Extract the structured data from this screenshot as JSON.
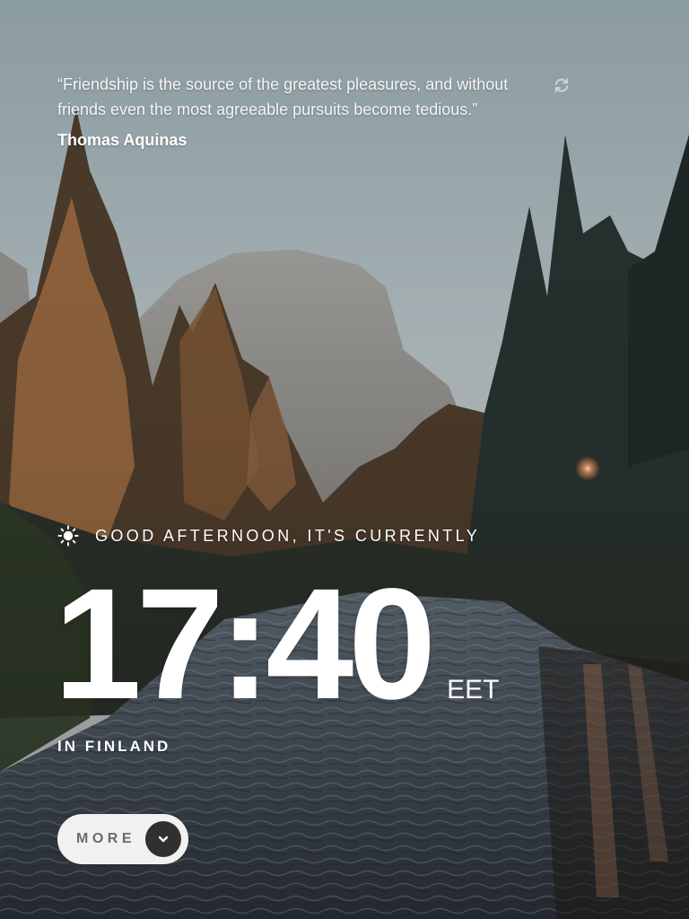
{
  "quote": {
    "text": "“Friendship is the source of the greatest pleasures, and without friends even the most agreeable pursuits become tedious.”",
    "author": "Thomas Aquinas",
    "refresh_icon": "refresh-icon"
  },
  "greeting": {
    "icon": "sun-icon",
    "text": "GOOD AFTERNOON, IT'S CURRENTLY"
  },
  "clock": {
    "time": "17:40",
    "timezone": "EET"
  },
  "location": {
    "text": "IN FINLAND"
  },
  "more_button": {
    "label": "MORE",
    "icon": "chevron-down-icon"
  },
  "colors": {
    "text": "#ffffff",
    "button_bg": "#f1f1f1",
    "button_text": "#6b6b6b",
    "button_circle": "#303030"
  }
}
